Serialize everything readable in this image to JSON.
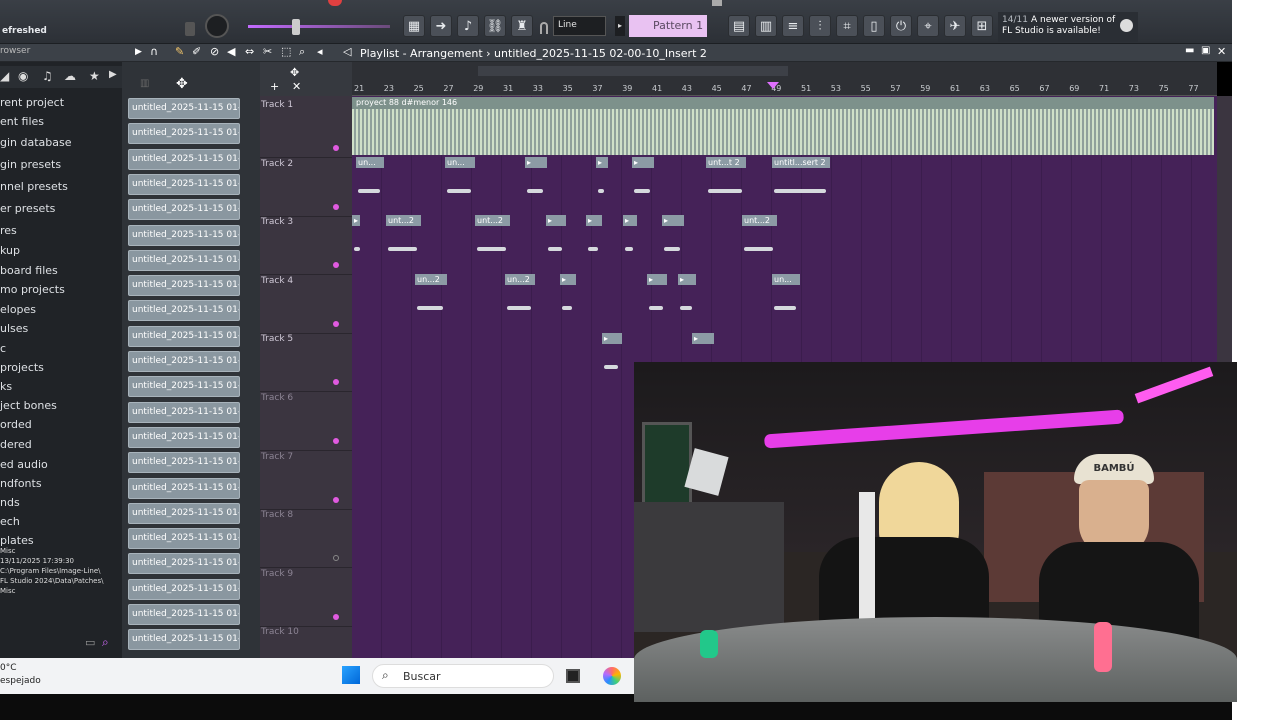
{
  "toolbar": {
    "status_label": "efreshed",
    "snap_mode": "Line",
    "pattern": "Pattern 1",
    "news_date": "14/11",
    "news_text_1": "A newer version of",
    "news_text_2": "FL Studio is available!",
    "accent_color": "#d46bff"
  },
  "playlist": {
    "breadcrumb": "Playlist - Arrangement › untitled_2025-11-15 02-00-10_Insert 2",
    "ruler_numbers": [
      "21",
      "23",
      "25",
      "27",
      "29",
      "31",
      "33",
      "35",
      "37",
      "39",
      "41",
      "43",
      "45",
      "47",
      "49",
      "51",
      "53",
      "55",
      "57",
      "59",
      "61",
      "63",
      "65",
      "67",
      "69",
      "71",
      "73",
      "75",
      "77"
    ],
    "tracks": [
      "Track 1",
      "Track 2",
      "Track 3",
      "Track 4",
      "Track 5",
      "Track 6",
      "Track 7",
      "Track 8",
      "Track 9",
      "Track 10"
    ],
    "main_clip_label": "proyect 88 d#menor 146",
    "clip_labels": {
      "un": "un...",
      "un2": "unt...2",
      "unt2b": "unt...t 2",
      "untitl": "untitl...sert 2",
      "un_2": "un...2",
      "un_dots": "un..."
    },
    "grid_color": "#452258"
  },
  "browser": {
    "header": "rowser",
    "items": [
      "rent project",
      "ent files",
      "gin database",
      "gin presets",
      "nnel presets",
      "er presets",
      "res",
      "kup",
      "board files",
      "mo projects",
      "elopes",
      "ulses",
      "c",
      "projects",
      "ks",
      "ject bones",
      "orded",
      "dered",
      "ed audio",
      "ndfonts",
      "nds",
      "ech",
      "plates"
    ],
    "info_line1": "Misc",
    "info_line2": "13/11/2025 17:39:30",
    "info_line3": "C:\\Program Files\\Image-Line\\",
    "info_line4": "FL Studio 2024\\Data\\Patches\\",
    "info_line5": "Misc"
  },
  "picker": {
    "item_label": "untitled_2025-11-15 01-..."
  },
  "taskbar": {
    "temp": "0°C",
    "weather": "espejado",
    "search_placeholder": "Buscar"
  },
  "webcam": {
    "cap_text": "BAMBÚ"
  }
}
